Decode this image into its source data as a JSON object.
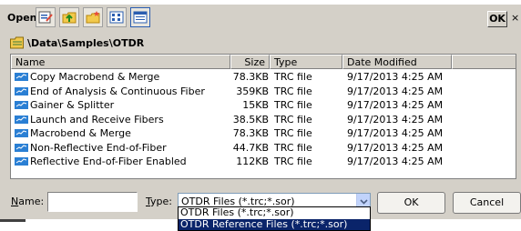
{
  "dialog": {
    "title": "Open",
    "ok_label": "OK",
    "close_label": "×",
    "toolbar_icons": [
      "properties-icon",
      "up-folder-icon",
      "new-folder-icon",
      "list-view-icon",
      "details-view-icon"
    ]
  },
  "path": "\\Data\\Samples\\OTDR",
  "columns": {
    "name": "Name",
    "size": "Size",
    "type": "Type",
    "date": "Date Modified"
  },
  "files": [
    {
      "name": "Copy Macrobend & Merge",
      "size": "78.3KB",
      "type": "TRC file",
      "date": "9/17/2013 4:25 AM"
    },
    {
      "name": "End of Analysis & Continuous Fiber",
      "size": "359KB",
      "type": "TRC file",
      "date": "9/17/2013 4:25 AM"
    },
    {
      "name": "Gainer & Splitter",
      "size": "15KB",
      "type": "TRC file",
      "date": "9/17/2013 4:25 AM"
    },
    {
      "name": "Launch and Receive Fibers",
      "size": "38.5KB",
      "type": "TRC file",
      "date": "9/17/2013 4:25 AM"
    },
    {
      "name": "Macrobend & Merge",
      "size": "78.3KB",
      "type": "TRC file",
      "date": "9/17/2013 4:25 AM"
    },
    {
      "name": "Non-Reflective End-of-Fiber",
      "size": "44.7KB",
      "type": "TRC file",
      "date": "9/17/2013 4:25 AM"
    },
    {
      "name": "Reflective End-of-Fiber Enabled",
      "size": "112KB",
      "type": "TRC file",
      "date": "9/17/2013 4:25 AM"
    }
  ],
  "bottom": {
    "name_label_u": "N",
    "name_label_rest": "ame:",
    "name_value": "",
    "type_label_u": "T",
    "type_label_rest": "ype:",
    "type_selected": "OTDR Files (*.trc;*.sor)",
    "ok_label": "OK",
    "cancel_label": "Cancel"
  },
  "dropdown_options": [
    {
      "label": "OTDR Files (*.trc;*.sor)",
      "selected": false
    },
    {
      "label": "OTDR Reference Files (*.trc;*.sor)",
      "selected": true
    }
  ],
  "colors": {
    "dialog_bg": "#d4d0c8",
    "selection": "#0a246a",
    "file_icon": "#2a7fd4"
  }
}
